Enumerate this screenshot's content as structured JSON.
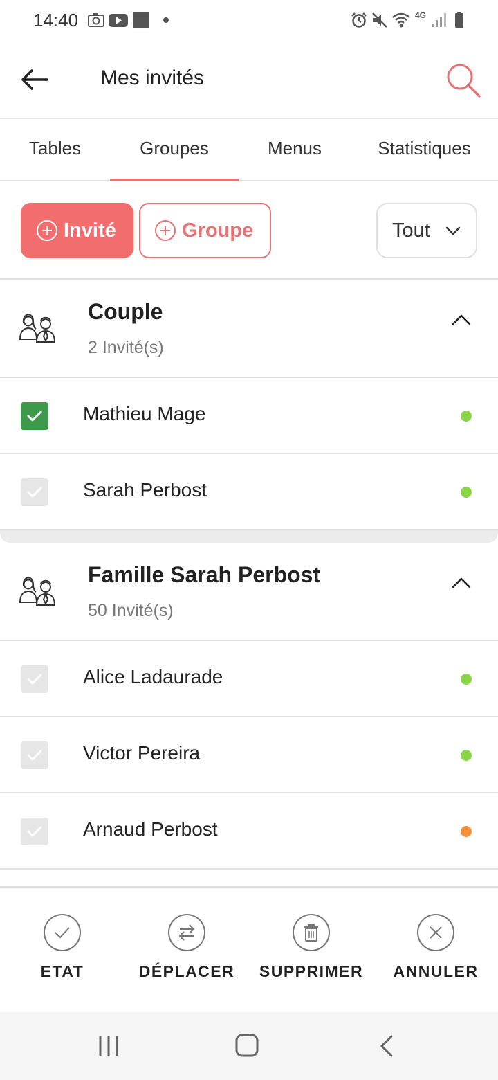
{
  "status_bar": {
    "time": "14:40",
    "left_icons": [
      "camera-icon",
      "youtube-icon",
      "square-icon",
      "dot-icon"
    ],
    "right_icons": [
      "alarm-icon",
      "mute-icon",
      "wifi-icon",
      "4g-icon",
      "signal-icon",
      "battery-icon"
    ],
    "network_label": "4G"
  },
  "app_bar": {
    "title": "Mes invités",
    "back_icon": "arrow-left-icon",
    "search_icon": "search-icon",
    "accent_color": "#e57373"
  },
  "tabs": [
    {
      "label": "Tables",
      "selected": false
    },
    {
      "label": "Groupes",
      "selected": true
    },
    {
      "label": "Menus",
      "selected": false
    },
    {
      "label": "Statistiques",
      "selected": false
    }
  ],
  "actions": {
    "add_guest_label": "Invité",
    "add_group_label": "Groupe",
    "filter_value": "Tout",
    "primary_color": "#f26e6e"
  },
  "groups": [
    {
      "name": "Couple",
      "count": "2 Invité(s)",
      "guests": [
        {
          "name": "Mathieu Mage",
          "checked": true,
          "status_color": "#8bd449"
        },
        {
          "name": "Sarah Perbost",
          "checked": false,
          "status_color": "#8bd449"
        }
      ]
    },
    {
      "name": "Famille Sarah Perbost",
      "count": "50 Invité(s)",
      "guests": [
        {
          "name": "Alice Ladaurade",
          "checked": false,
          "status_color": "#8bd449"
        },
        {
          "name": "Victor Pereira",
          "checked": false,
          "status_color": "#8bd449"
        },
        {
          "name": "Arnaud Perbost",
          "checked": false,
          "status_color": "#f5923e"
        }
      ]
    }
  ],
  "bottom_actions": [
    {
      "label": "ETAT",
      "icon": "check-circle-icon"
    },
    {
      "label": "DÉPLACER",
      "icon": "swap-icon"
    },
    {
      "label": "SUPPRIMER",
      "icon": "trash-icon"
    },
    {
      "label": "ANNULER",
      "icon": "close-circle-icon"
    }
  ],
  "nav_bar": {
    "icons": [
      "recents-icon",
      "home-icon",
      "back-icon"
    ]
  }
}
